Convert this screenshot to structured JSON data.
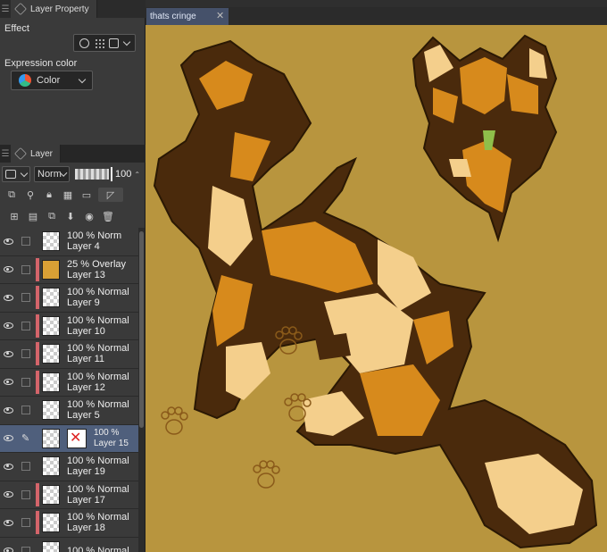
{
  "layer_property": {
    "title": "Layer Property",
    "effect_label": "Effect",
    "expression_color_label": "Expression color",
    "expression_color_value": "Color"
  },
  "layer_panel": {
    "title": "Layer",
    "blend_mode": "Norm",
    "opacity": "100",
    "layers": [
      {
        "blend": "100 % Norm",
        "name": "Layer 4",
        "clip": "",
        "thumb": "checker",
        "selected": false
      },
      {
        "blend": "25 % Overlay",
        "name": "Layer 13",
        "clip": "#d4646a",
        "thumb": "orange",
        "selected": false
      },
      {
        "blend": "100 % Normal",
        "name": "Layer 9",
        "clip": "#d4646a",
        "thumb": "checker",
        "selected": false
      },
      {
        "blend": "100 % Normal",
        "name": "Layer 10",
        "clip": "#d4646a",
        "thumb": "checker",
        "selected": false
      },
      {
        "blend": "100 % Normal",
        "name": "Layer 11",
        "clip": "#d4646a",
        "thumb": "checker",
        "selected": false
      },
      {
        "blend": "100 % Normal",
        "name": "Layer 12",
        "clip": "#d4646a",
        "thumb": "checker",
        "selected": false
      },
      {
        "blend": "100 % Normal",
        "name": "Layer 5",
        "clip": "",
        "thumb": "checker",
        "selected": false
      },
      {
        "blend": "100 %",
        "name": "Layer 15",
        "clip": "",
        "thumb": "checker",
        "selected": true
      },
      {
        "blend": "100 % Normal",
        "name": "Layer 19",
        "clip": "",
        "thumb": "checker",
        "selected": false
      },
      {
        "blend": "100 % Normal",
        "name": "Layer 17",
        "clip": "#d4646a",
        "thumb": "checker",
        "selected": false
      },
      {
        "blend": "100 % Normal",
        "name": "Layer 18",
        "clip": "#d4646a",
        "thumb": "checker",
        "selected": false
      },
      {
        "blend": "100 % Normal",
        "name": "",
        "clip": "",
        "thumb": "checker",
        "selected": false
      }
    ]
  },
  "document_tab": {
    "title": "thats cringe",
    "close_icon": "close-icon"
  },
  "colors": {
    "canvas_bg": "#b8953e",
    "dark_brown": "#4a2a0c",
    "orange": "#d78a1c",
    "cream": "#f4cf8c",
    "selection": "#4f5f7c"
  }
}
